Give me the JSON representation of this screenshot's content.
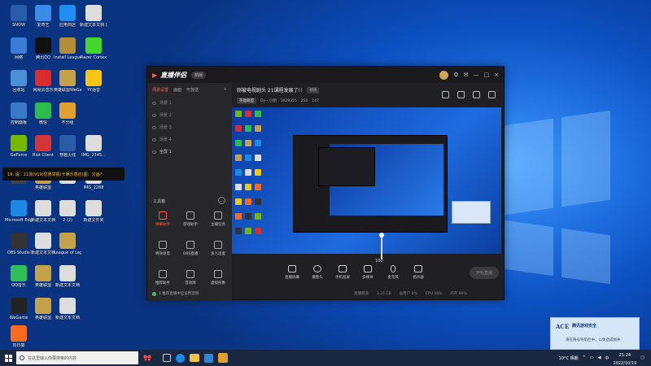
{
  "desktop_icons": [
    {
      "label": "SNOW",
      "color": "#2a5caa"
    },
    {
      "label": "网络",
      "color": "#3a7bd5"
    },
    {
      "label": "回收站",
      "color": "#4a8fd8"
    },
    {
      "label": "控制面板",
      "color": "#3c78c8"
    },
    {
      "label": "GeForce",
      "color": "#76b900"
    },
    {
      "label": "",
      "color": "#444"
    },
    {
      "label": "Microsoft Edge",
      "color": "#1e88e5"
    },
    {
      "label": "OBS Studio",
      "color": "#333"
    },
    {
      "label": "QQ音乐",
      "color": "#2fbe5a"
    },
    {
      "label": "WeGame",
      "color": "#222"
    },
    {
      "label": "向日葵",
      "color": "#ff6a1f"
    },
    {
      "label": "爱奇艺",
      "color": "#3d8be8"
    },
    {
      "label": "腾讯QQ",
      "color": "#111"
    },
    {
      "label": "网易云音乐",
      "color": "#d92d2d"
    },
    {
      "label": "微信",
      "color": "#2dbb4e"
    },
    {
      "label": "Riot Client",
      "color": "#d13639"
    },
    {
      "label": "英雄联盟",
      "color": "#c4a24b"
    },
    {
      "label": "新建文本文档",
      "color": "#ddd"
    },
    {
      "label": "新建文本文档",
      "color": "#ddd"
    },
    {
      "label": "英雄联盟",
      "color": "#c4a24b"
    },
    {
      "label": "英雄联盟",
      "color": "#c4a24b"
    },
    {
      "label": "应用商店",
      "color": "#1f8ef1"
    },
    {
      "label": "Install League of...",
      "color": "#b48d39"
    },
    {
      "label": "英雄联盟WeGame版",
      "color": "#c4a24b"
    },
    {
      "label": "不分组",
      "color": "#e0a030"
    },
    {
      "label": "穿越火线",
      "color": "#2a5caa"
    },
    {
      "label": "",
      "color": "#ddd"
    },
    {
      "label": "2 (2)",
      "color": "#ddd"
    },
    {
      "label": "League of Legends",
      "color": "#c4a24b"
    },
    {
      "label": "新建文本文档",
      "color": "#ddd"
    },
    {
      "label": "新建文本文档",
      "color": "#ddd"
    },
    {
      "label": "新建文本文档 (2)",
      "color": "#ddd"
    },
    {
      "label": "Razer Cortex",
      "color": "#44d62c"
    },
    {
      "label": "YY语音",
      "color": "#f5c518"
    },
    {
      "label": "IMG_2345...",
      "color": "#ddd"
    },
    {
      "label": "IMG_2268",
      "color": "#ddd"
    },
    {
      "label": "新建文件夹",
      "color": "#ddd"
    }
  ],
  "app": {
    "logo": "直播伴侣",
    "badge": "新版",
    "window_controls": [
      "—",
      "□",
      "×"
    ],
    "left_tabs": [
      "场景设置",
      "画面",
      "可放送"
    ],
    "scenes": [
      "场景 1",
      "场景 2",
      "场景 3",
      "场景 4"
    ],
    "active_scene": "全屏 1",
    "tools_title": "工具箱",
    "tools": [
      {
        "label": "弹幕助手",
        "red": true
      },
      {
        "label": "游戏助手",
        "red": false
      },
      {
        "label": "主播任务",
        "red": false
      },
      {
        "label": "特效语音",
        "red": false
      },
      {
        "label": "OBS直播",
        "red": false
      },
      {
        "label": "多人连麦",
        "red": false
      },
      {
        "label": "推荐助手",
        "red": false
      },
      {
        "label": "音效库",
        "red": false
      },
      {
        "label": "虚拟形象",
        "red": false
      }
    ],
    "footer_text": "1.推荐直播中应该用音频",
    "stream_title": "刚被电视剧头 21课程发展了!!",
    "edit_label": "修改",
    "meta_tag": "英雄联盟",
    "meta_items": [
      "Dy-- 小明",
      "1929355",
      "250",
      "147"
    ],
    "tooltip": "19: 请：11流(V19)优惠举报(卡娱乐感应)图：又画?",
    "zoom_value": "100",
    "bottom_buttons": [
      "直播屏幕",
      "摄像头",
      "手机投屏",
      "多媒体",
      "麦克风",
      "扬声器"
    ],
    "start_live": "开始直播",
    "status_items": [
      "直播频道",
      "1.25 CB",
      "总用户 0%",
      "CPU 16%",
      "内存 80%"
    ]
  },
  "taskbar": {
    "search_placeholder": "在这里输入你要搜索的内容",
    "weather": "10°C 晴朗",
    "lang": "中",
    "time": "21:24",
    "date": "2022/10/19"
  },
  "toast": {
    "logo": "ACE",
    "title": "腾讯游戏安全",
    "body": "请在账号导航栏中，以免造成损失"
  }
}
